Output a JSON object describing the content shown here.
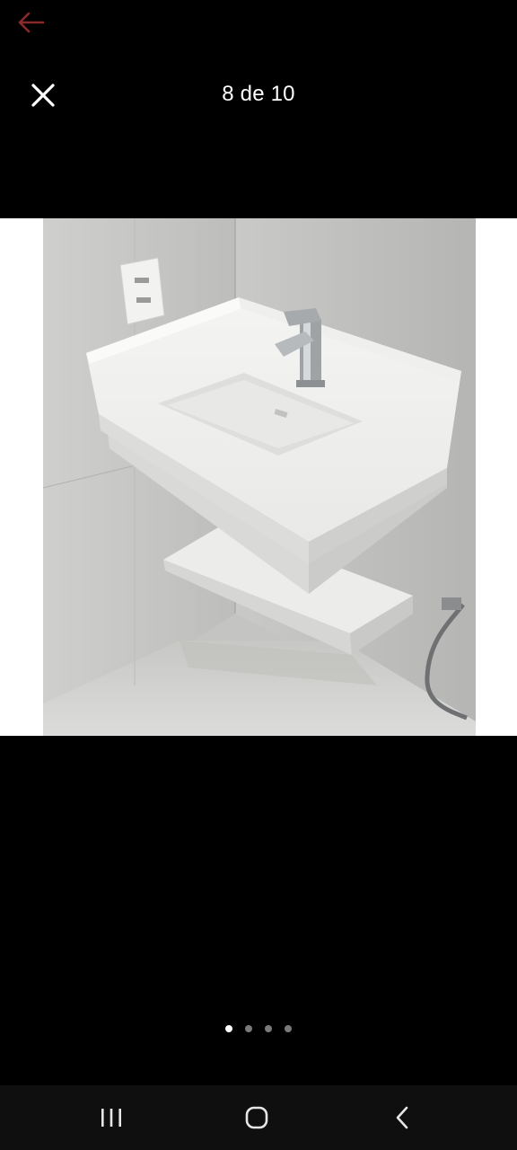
{
  "header": {
    "counter_text": "8 de 10"
  },
  "icons": {
    "back": "arrow-left-icon",
    "close": "close-icon",
    "recents": "recents-icon",
    "home": "home-icon",
    "nav_back": "chevron-left-icon"
  },
  "colors": {
    "background": "#000000",
    "back_arrow": "#8b2a2a",
    "indicator_active": "#ffffff",
    "indicator_inactive": "#7a7a7a"
  },
  "pager": {
    "current_index": 8,
    "total": 10,
    "visible_dots": 4,
    "active_dot": 0
  }
}
